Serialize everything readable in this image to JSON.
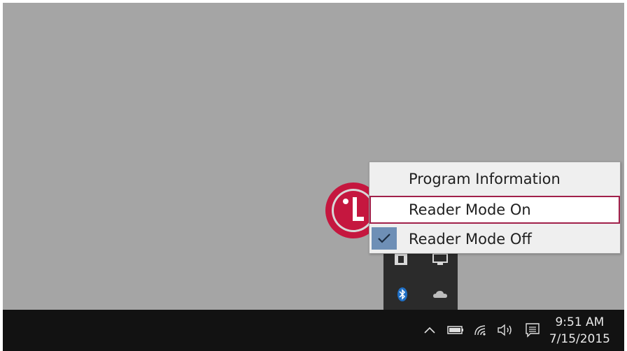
{
  "context_menu": {
    "items": [
      {
        "label": "Program Information",
        "checked": false,
        "highlighted": false
      },
      {
        "label": "Reader Mode On",
        "checked": false,
        "highlighted": true
      },
      {
        "label": "Reader Mode Off",
        "checked": true,
        "highlighted": false
      }
    ]
  },
  "tray_overflow": {
    "icons": [
      "reader-mode-icon",
      "monitor-icon",
      "bluetooth-icon",
      "onedrive-icon"
    ]
  },
  "taskbar": {
    "icons": [
      "chevron-up-icon",
      "battery-icon",
      "wifi-icon",
      "volume-icon",
      "action-center-icon"
    ],
    "clock": {
      "time": "9:51 AM",
      "date": "7/15/2015"
    }
  },
  "colors": {
    "desktop": "#a5a5a5",
    "taskbar": "#121212",
    "highlight_border": "#a0204a",
    "check_background": "#6e8fb6",
    "lg_red": "#c5173f"
  }
}
